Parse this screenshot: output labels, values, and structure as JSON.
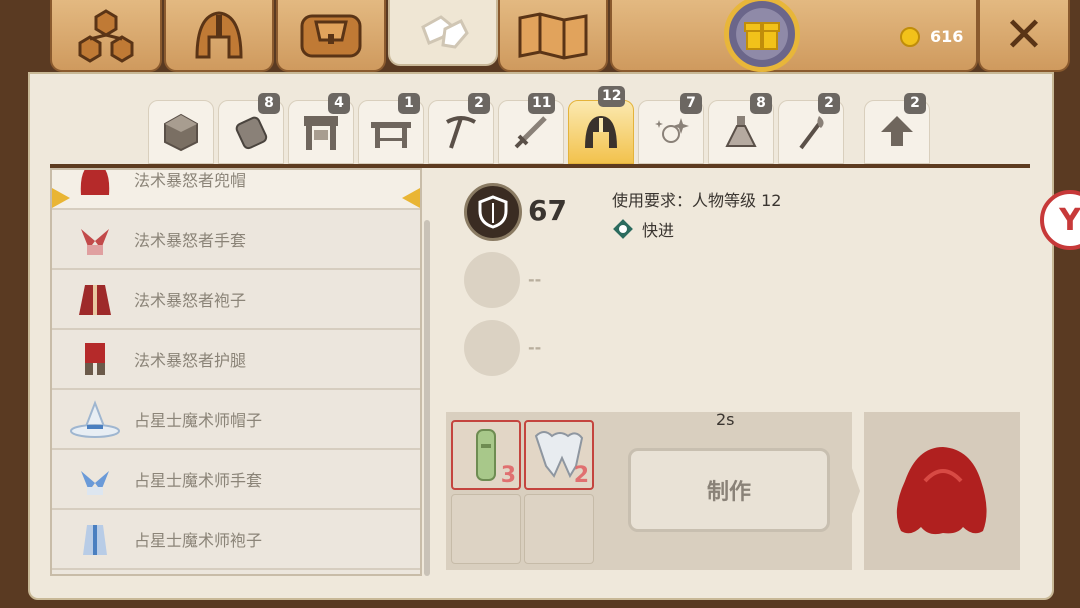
{
  "top_tabs": [
    {
      "icon": "skill-tree-icon"
    },
    {
      "icon": "helmet-icon"
    },
    {
      "icon": "bag-icon"
    },
    {
      "icon": "crafting-hands-icon",
      "active": true
    },
    {
      "icon": "map-icon"
    }
  ],
  "currency": {
    "value": "616",
    "icon": "gold-coin-icon"
  },
  "gift": {
    "icon": "gift-icon"
  },
  "close": {
    "label": "✕",
    "icon": "close-icon"
  },
  "category_tabs": [
    {
      "icon": "cube-icon",
      "badge": ""
    },
    {
      "icon": "armor-icon",
      "badge": "8"
    },
    {
      "icon": "gate-icon",
      "badge": "4"
    },
    {
      "icon": "table-icon",
      "badge": "1"
    },
    {
      "icon": "pickaxe-icon",
      "badge": "2"
    },
    {
      "icon": "sword-icon",
      "badge": "11"
    },
    {
      "icon": "helmet-icon",
      "badge": "12",
      "active": true
    },
    {
      "icon": "sparkle-icon",
      "badge": "7"
    },
    {
      "icon": "potion-icon",
      "badge": "8"
    },
    {
      "icon": "torch-icon",
      "badge": "2"
    },
    {
      "icon": "upgrade-arrow-icon",
      "badge": "2"
    }
  ],
  "items": [
    {
      "label": "法术暴怒者兜帽",
      "icon": "red-hood-icon",
      "selected": true
    },
    {
      "label": "法术暴怒者手套",
      "icon": "red-gloves-icon"
    },
    {
      "label": "法术暴怒者袍子",
      "icon": "red-robe-icon"
    },
    {
      "label": "法术暴怒者护腿",
      "icon": "red-leggings-icon"
    },
    {
      "label": "占星士魔术师帽子",
      "icon": "wizard-hat-icon"
    },
    {
      "label": "占星士魔术师手套",
      "icon": "blue-gloves-icon"
    },
    {
      "label": "占星士魔术师袍子",
      "icon": "blue-robe-icon"
    }
  ],
  "detail": {
    "stat_value": "67",
    "stat_icon": "shield-icon",
    "requirement": "使用要求：人物等级 12",
    "trait": "快进",
    "trait_icon": "clock-badge-icon",
    "empty_stats": [
      "--",
      "--"
    ]
  },
  "craft": {
    "time": "2s",
    "button_label": "制作",
    "materials": [
      {
        "icon": "scroll-icon",
        "count": "3"
      },
      {
        "icon": "tooth-icon",
        "count": "2"
      }
    ],
    "result_icon": "red-hood-icon"
  },
  "colors": {
    "accent": "#f2c24d",
    "panel": "#efe8db",
    "wood": "#cf9a5e",
    "dark": "#5d3b20",
    "material_border": "#c4443e"
  }
}
